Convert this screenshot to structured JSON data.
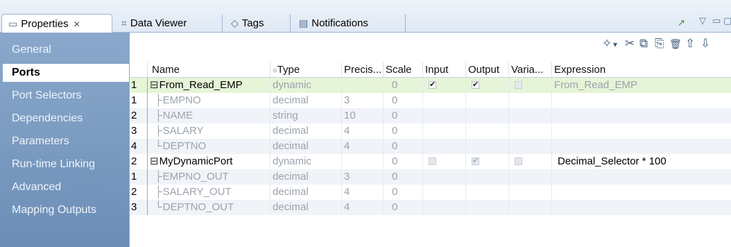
{
  "tabs": [
    {
      "label": "Properties",
      "icon": "properties-icon",
      "glyph": "▭",
      "close": "✕",
      "active": true
    },
    {
      "label": "Data Viewer",
      "icon": "data-viewer-icon",
      "glyph": "⌗",
      "active": false
    },
    {
      "label": "Tags",
      "icon": "tag-icon",
      "glyph": "◇",
      "active": false
    },
    {
      "label": "Notifications",
      "icon": "notifications-icon",
      "glyph": "▤",
      "active": false
    }
  ],
  "window_controls": {
    "open": "↗",
    "menu": "▽",
    "minimize": "▭",
    "maximize": "▢"
  },
  "sidebar": {
    "items": [
      {
        "label": "General",
        "active": false
      },
      {
        "label": "Ports",
        "active": true
      },
      {
        "label": "Port Selectors",
        "active": false
      },
      {
        "label": "Dependencies",
        "active": false
      },
      {
        "label": "Parameters",
        "active": false
      },
      {
        "label": "Run-time Linking",
        "active": false
      },
      {
        "label": "Advanced",
        "active": false
      },
      {
        "label": "Mapping Outputs",
        "active": false
      }
    ]
  },
  "toolbar": {
    "new": "✧",
    "dropdown": "▾",
    "cut": "✂",
    "copy": "⧉",
    "paste": "⎘",
    "delete": "🗑",
    "move_up": "⇧",
    "move_down": "⇩"
  },
  "grid": {
    "headers": [
      "",
      "Name",
      "Type",
      "Precis...",
      "Scale",
      "Input",
      "Output",
      "Varia...",
      "Expression"
    ],
    "type_marker": "○",
    "rows": [
      {
        "num": "1",
        "name": "From_Read_EMP",
        "level": "parent",
        "type": "dynamic",
        "precision": "",
        "scale": "0",
        "input": "✔",
        "output": "✔",
        "variable": "",
        "input_state": "on",
        "output_state": "on",
        "variable_state": "dis",
        "expression": "From_Read_EMP",
        "style": "sel",
        "expr_grey": true
      },
      {
        "num": "1",
        "name": "EMPNO",
        "level": "child",
        "type": "decimal",
        "precision": "3",
        "scale": "0",
        "expression": "",
        "style": ""
      },
      {
        "num": "2",
        "name": "NAME",
        "level": "child",
        "type": "string",
        "precision": "10",
        "scale": "0",
        "expression": "",
        "style": "alt"
      },
      {
        "num": "3",
        "name": "SALARY",
        "level": "child",
        "type": "decimal",
        "precision": "4",
        "scale": "0",
        "expression": "",
        "style": ""
      },
      {
        "num": "4",
        "name": "DEPTNO",
        "level": "child",
        "type": "decimal",
        "precision": "4",
        "scale": "0",
        "expression": "",
        "style": "alt",
        "last": true
      },
      {
        "num": "2",
        "name": "MyDynamicPort",
        "level": "parent",
        "type": "dynamic",
        "precision": "",
        "scale": "0",
        "input": "",
        "output": "✔",
        "variable": "",
        "input_state": "dis",
        "output_state": "dis",
        "variable_state": "dis",
        "expression": "Decimal_Selector * 100",
        "style": "",
        "expr_grey": false
      },
      {
        "num": "1",
        "name": "EMPNO_OUT",
        "level": "child",
        "type": "decimal",
        "precision": "3",
        "scale": "0",
        "expression": "",
        "style": "alt"
      },
      {
        "num": "2",
        "name": "SALARY_OUT",
        "level": "child",
        "type": "decimal",
        "precision": "4",
        "scale": "0",
        "expression": "",
        "style": ""
      },
      {
        "num": "3",
        "name": "DEPTNO_OUT",
        "level": "child",
        "type": "decimal",
        "precision": "4",
        "scale": "0",
        "expression": "",
        "style": "alt",
        "last": true
      }
    ]
  }
}
